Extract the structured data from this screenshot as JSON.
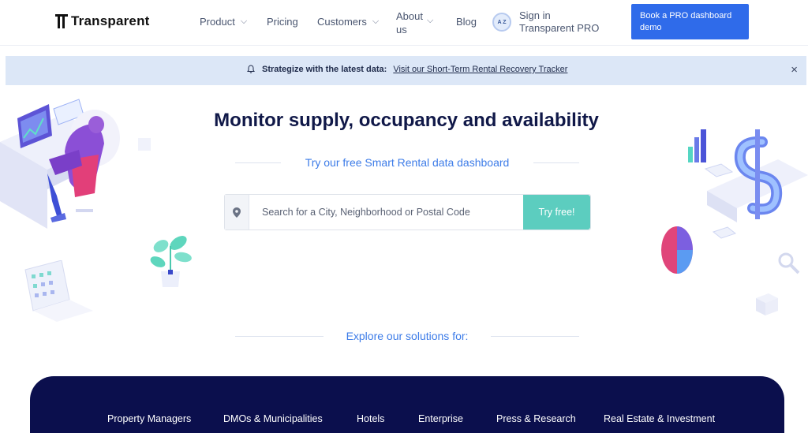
{
  "nav": {
    "logo_text": "Transparent",
    "product": "Product",
    "pricing": "Pricing",
    "customers": "Customers",
    "about": "About us",
    "blog": "Blog",
    "signin_badge": "A Z",
    "signin": "Sign in Transparent PRO",
    "cta": "Book a PRO dashboard demo",
    "chevron": "⌵"
  },
  "banner": {
    "label": "Strategize with the latest data:",
    "link": "Visit our Short-Term Rental Recovery Tracker",
    "close": "×"
  },
  "hero": {
    "title": "Monitor supply, occupancy and availability",
    "subtitle": "Try our free Smart Rental data dashboard",
    "search_placeholder": "Search for a City, Neighborhood or Postal Code",
    "try_button": "Try free!"
  },
  "explore": {
    "heading": "Explore our solutions for:"
  },
  "solutions": [
    "Property Managers",
    "DMOs & Municipalities",
    "Hotels",
    "Enterprise",
    "Press & Research",
    "Real Estate & Investment"
  ],
  "colors": {
    "brand_blue": "#2f6bea",
    "navy": "#0b0f4d",
    "teal": "#5ccdbf",
    "banner_bg": "#dce7f7",
    "link_blue": "#3d7ce8"
  }
}
